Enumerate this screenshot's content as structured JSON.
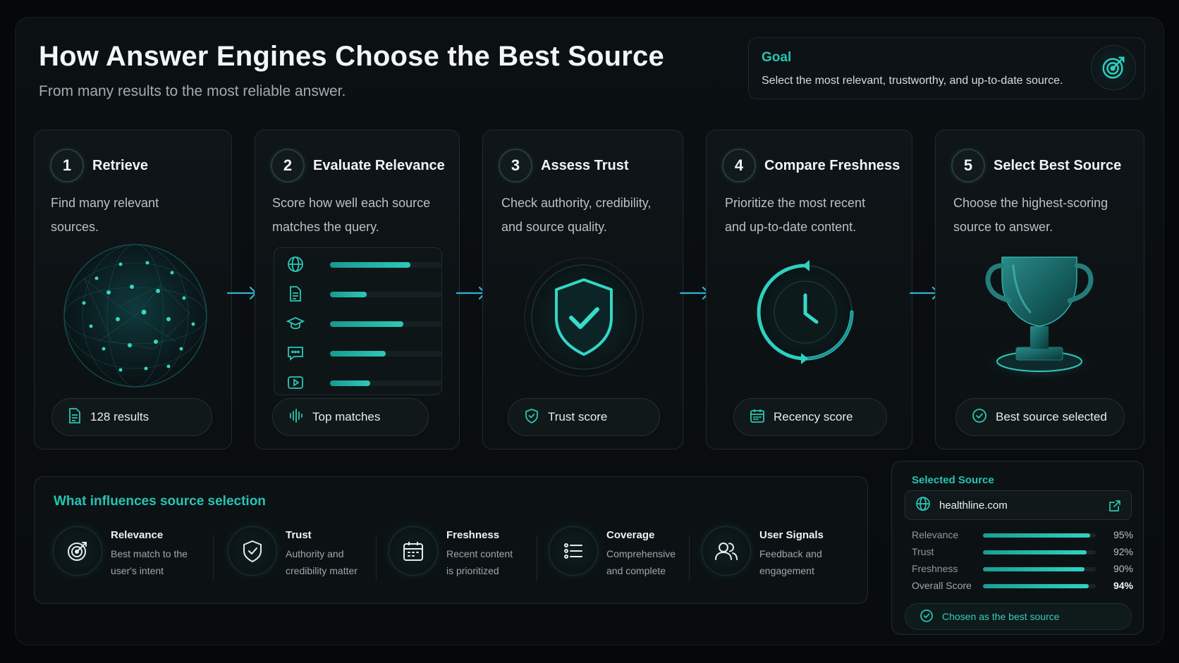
{
  "header": {
    "title": "How Answer Engines Choose the Best Source",
    "subtitle": "From many results to the most reliable answer."
  },
  "goal": {
    "label": "Goal",
    "text": "Select the most relevant, trustworthy, and up-to-date source.",
    "icon": "target-icon"
  },
  "steps": [
    {
      "number": "1",
      "title": "Retrieve",
      "desc_line1": "Find many relevant",
      "desc_line2": "sources.",
      "pill": "128 results",
      "pill_icon": "document-icon",
      "visual": "network-sphere"
    },
    {
      "number": "2",
      "title": "Evaluate Relevance",
      "desc_line1": "Score how well each source",
      "desc_line2": "matches the query.",
      "pill": "Top matches",
      "pill_icon": "waveform-icon",
      "visual": "scored-list",
      "scores": [
        {
          "icon": "globe-icon",
          "score": 0.72
        },
        {
          "icon": "document-icon",
          "score": 0.33
        },
        {
          "icon": "graduation-cap-icon",
          "score": 0.66
        },
        {
          "icon": "chat-bubble-icon",
          "score": 0.5
        },
        {
          "icon": "play-icon",
          "score": 0.36
        }
      ]
    },
    {
      "number": "3",
      "title": "Assess Trust",
      "desc_line1": "Check authority, credibility,",
      "desc_line2": "and source quality.",
      "pill": "Trust score",
      "pill_icon": "shield-check-icon",
      "visual": "shield"
    },
    {
      "number": "4",
      "title": "Compare Freshness",
      "desc_line1": "Prioritize the most recent",
      "desc_line2": "and up-to-date content.",
      "pill": "Recency score",
      "pill_icon": "calendar-icon",
      "visual": "clock"
    },
    {
      "number": "5",
      "title": "Select Best Source",
      "desc_line1": "Choose the highest-scoring",
      "desc_line2": "source to answer.",
      "pill": "Best source selected",
      "pill_icon": "check-circle-icon",
      "visual": "trophy"
    }
  ],
  "factors": {
    "title": "What influences source selection",
    "items": [
      {
        "name": "Relevance",
        "desc_line1": "Best match to the",
        "desc_line2": "user's intent",
        "icon": "target-icon"
      },
      {
        "name": "Trust",
        "desc_line1": "Authority and",
        "desc_line2": "credibility matter",
        "icon": "shield-check-icon"
      },
      {
        "name": "Freshness",
        "desc_line1": "Recent content",
        "desc_line2": "is prioritized",
        "icon": "calendar-icon"
      },
      {
        "name": "Coverage",
        "desc_line1": "Comprehensive",
        "desc_line2": "and complete",
        "icon": "list-icon"
      },
      {
        "name": "User Signals",
        "desc_line1": "Feedback and",
        "desc_line2": "engagement",
        "icon": "users-icon"
      }
    ]
  },
  "selected": {
    "label": "Selected Source",
    "source": "healthline.com",
    "metrics": [
      {
        "name": "Relevance",
        "value": "95%",
        "fraction": 0.95
      },
      {
        "name": "Trust",
        "value": "92%",
        "fraction": 0.92
      },
      {
        "name": "Freshness",
        "value": "90%",
        "fraction": 0.9
      },
      {
        "name": "Overall Score",
        "value": "94%",
        "fraction": 0.94
      }
    ],
    "chosen": "Chosen as the best source"
  },
  "colors": {
    "accent": "#27c3b3",
    "background": "#080c0e",
    "card": "#0f1518"
  }
}
